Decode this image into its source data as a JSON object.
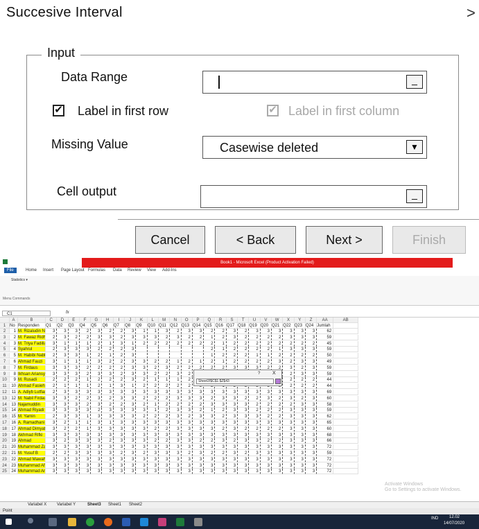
{
  "dialog": {
    "title": "Succesive Interval",
    "close": ">",
    "input_legend": "Input",
    "data_range_label": "Data Range",
    "data_range_value": "",
    "label_first_row": "Label in first row",
    "label_first_row_checked": true,
    "label_first_column": "Label in first column",
    "label_first_column_checked": true,
    "missing_value_label": "Missing Value",
    "missing_value_selected": "Casewise deleted",
    "cell_output_label": "Cell output",
    "cell_output_value": "",
    "buttons": {
      "cancel": "Cancel",
      "back": "< Back",
      "next": "Next >",
      "finish": "Finish"
    },
    "button_glyph": "_",
    "dropdown_glyph": "▼",
    "check_glyph": "✔"
  },
  "excel": {
    "title": "Book1 - Microsoft Excel (Product Activation Failed)",
    "tabs": [
      "File",
      "Home",
      "Insert",
      "Page Layout",
      "Formulas",
      "Data",
      "Review",
      "View",
      "Add-Ins"
    ],
    "statistics_menu": "Statistics ▾",
    "menu_commands": "Menu Commands",
    "name_box": "C1",
    "fx": "fx",
    "columns": [
      "A",
      "B",
      "C",
      "D",
      "E",
      "F",
      "G",
      "H",
      "I",
      "J",
      "K",
      "L",
      "M",
      "N",
      "O",
      "P",
      "Q",
      "R",
      "S",
      "T",
      "U",
      "V",
      "W",
      "X",
      "Y",
      "Z",
      "AA",
      "AB"
    ],
    "header_row": [
      "No",
      "Responden",
      "Q1",
      "Q2",
      "Q3",
      "Q4",
      "Q5",
      "Q6",
      "Q7",
      "Q8",
      "Q9",
      "Q10",
      "Q11",
      "Q12",
      "Q13",
      "Q14",
      "Q15",
      "Q16",
      "Q17",
      "Q18",
      "Q19",
      "Q20",
      "Q21",
      "Q22",
      "Q23",
      "Q24",
      "Jumlah"
    ],
    "rows": [
      {
        "no": "1",
        "name": "M. Rizaludin Nor Char",
        "q": [
          "3",
          "3",
          "3",
          "2",
          "3",
          "2",
          "2",
          "3",
          "1",
          "1",
          "3",
          "2",
          "3",
          "3",
          "2",
          "2",
          "3",
          "2",
          "3",
          "3",
          "3",
          "3",
          "3",
          "3"
        ],
        "total": "62"
      },
      {
        "no": "2",
        "name": "M. Fawaz Ridho Hifzh",
        "q": [
          "2",
          "3",
          "2",
          "2",
          "3",
          "3",
          "2",
          "3",
          "3",
          "3",
          "2",
          "3",
          "2",
          "2",
          "1",
          "2",
          "3",
          "2",
          "2",
          "2",
          "2",
          "3",
          "3",
          "3"
        ],
        "total": "59"
      },
      {
        "no": "3",
        "name": "M. Triya Fadillah",
        "q": [
          "3",
          "1",
          "1",
          "1",
          "2",
          "1",
          "3",
          "1",
          "2",
          "2",
          "2",
          "2",
          "2",
          "2",
          "2",
          "1",
          "2",
          "2",
          "2",
          "2",
          "2",
          "2",
          "2",
          "2"
        ],
        "total": "45"
      },
      {
        "no": "4",
        "name": "Syahrul",
        "q": [
          "2",
          "3",
          "3",
          "3",
          "2",
          "2",
          "2",
          "3",
          "",
          "",
          "",
          "",
          "",
          "",
          "2",
          "1",
          "2",
          "2",
          "2",
          "2",
          "1",
          "3",
          "3",
          "3"
        ],
        "total": "59"
      },
      {
        "no": "5",
        "name": "M. Habibi Nabhani",
        "q": [
          "2",
          "3",
          "3",
          "1",
          "2",
          "1",
          "2",
          "3",
          "",
          "",
          "",
          "",
          "",
          "",
          "1",
          "2",
          "2",
          "2",
          "1",
          "1",
          "2",
          "2",
          "2",
          "2"
        ],
        "total": "50"
      },
      {
        "no": "6",
        "name": "Ahmad Fauzi",
        "q": [
          "3",
          "1",
          "1",
          "1",
          "3",
          "2",
          "2",
          "3",
          "3",
          "2",
          "2",
          "1",
          "2",
          "1",
          "2",
          "1",
          "2",
          "2",
          "2",
          "2",
          "3",
          "2",
          "3",
          "3"
        ],
        "total": "49"
      },
      {
        "no": "7",
        "name": "M. Firdaus",
        "q": [
          "3",
          "3",
          "3",
          "2",
          "2",
          "2",
          "2",
          "3",
          "3",
          "2",
          "3",
          "2",
          "2",
          "2",
          "2",
          "2",
          "3",
          "3",
          "3",
          "2",
          "2",
          "3",
          "2",
          "3"
        ],
        "total": "59"
      },
      {
        "no": "8",
        "name": "Ikhsan Ariansyah",
        "q": [
          "3",
          "3",
          "3",
          "2",
          "3",
          "3",
          "2",
          "3",
          "3",
          "2",
          "2",
          "3",
          "2",
          "2",
          "3",
          "2",
          "3",
          "3",
          "3",
          "2",
          "2",
          "2",
          "3",
          "3"
        ],
        "total": "59"
      },
      {
        "no": "9",
        "name": "M. Rusadi",
        "q": [
          "2",
          "2",
          "2",
          "1",
          "2",
          "2",
          "2",
          "3",
          "2",
          "1",
          "1",
          "1",
          "2",
          "2",
          "2",
          "1",
          "2",
          "2",
          "1",
          "2",
          "1",
          "2",
          "2",
          "2"
        ],
        "total": "44"
      },
      {
        "no": "10",
        "name": "Ahmad Fasieh",
        "q": [
          "2",
          "1",
          "1",
          "1",
          "2",
          "1",
          "3",
          "1",
          "2",
          "2",
          "2",
          "2",
          "2",
          "2",
          "2",
          "1",
          "2",
          "2",
          "2",
          "2",
          "2",
          "2",
          "2",
          "2"
        ],
        "total": "44"
      },
      {
        "no": "11",
        "name": "A. Adiyb Lutfian Noor",
        "q": [
          "2",
          "3",
          "3",
          "3",
          "3",
          "3",
          "3",
          "3",
          "3",
          "3",
          "3",
          "3",
          "3",
          "3",
          "3",
          "3",
          "3",
          "3",
          "3",
          "3",
          "3",
          "3",
          "3",
          "3"
        ],
        "total": "69"
      },
      {
        "no": "12",
        "name": "M. Nabil Firdaus",
        "q": [
          "3",
          "3",
          "2",
          "2",
          "3",
          "2",
          "3",
          "3",
          "2",
          "2",
          "2",
          "3",
          "3",
          "3",
          "2",
          "3",
          "3",
          "2",
          "2",
          "3",
          "2",
          "3",
          "2",
          "3"
        ],
        "total": "60"
      },
      {
        "no": "13",
        "name": "Najamuddin",
        "q": [
          "3",
          "3",
          "3",
          "2",
          "3",
          "2",
          "2",
          "3",
          "2",
          "1",
          "2",
          "2",
          "2",
          "2",
          "3",
          "3",
          "3",
          "3",
          "2",
          "2",
          "2",
          "2",
          "3",
          "3"
        ],
        "total": "58"
      },
      {
        "no": "14",
        "name": "Ahmad Riyadi",
        "q": [
          "3",
          "3",
          "3",
          "3",
          "2",
          "3",
          "3",
          "3",
          "3",
          "1",
          "2",
          "3",
          "3",
          "2",
          "1",
          "2",
          "3",
          "3",
          "2",
          "2",
          "2",
          "3",
          "3",
          "3"
        ],
        "total": "59"
      },
      {
        "no": "15",
        "name": "M. Yamin",
        "q": [
          "2",
          "3",
          "3",
          "1",
          "3",
          "3",
          "3",
          "3",
          "2",
          "2",
          "2",
          "3",
          "2",
          "3",
          "3",
          "2",
          "3",
          "3",
          "3",
          "2",
          "2",
          "3",
          "3",
          "3"
        ],
        "total": "62"
      },
      {
        "no": "16",
        "name": "A. Ramadhani",
        "q": [
          "3",
          "2",
          "1",
          "1",
          "3",
          "1",
          "3",
          "3",
          "3",
          "3",
          "3",
          "3",
          "3",
          "3",
          "3",
          "3",
          "3",
          "3",
          "3",
          "3",
          "3",
          "3",
          "3",
          "3"
        ],
        "total": "65"
      },
      {
        "no": "17",
        "name": "Ahmad Dimyati",
        "q": [
          "3",
          "2",
          "2",
          "1",
          "3",
          "3",
          "3",
          "3",
          "3",
          "2",
          "2",
          "3",
          "3",
          "3",
          "3",
          "2",
          "3",
          "2",
          "2",
          "2",
          "2",
          "3",
          "3",
          "3"
        ],
        "total": "60"
      },
      {
        "no": "18",
        "name": "Akhmad Rifki",
        "q": [
          "3",
          "3",
          "3",
          "3",
          "3",
          "3",
          "3",
          "3",
          "3",
          "3",
          "3",
          "3",
          "3",
          "3",
          "3",
          "3",
          "3",
          "3",
          "3",
          "3",
          "3",
          "3",
          "3",
          "3"
        ],
        "total": "68"
      },
      {
        "no": "19",
        "name": "Ahmad",
        "q": [
          "3",
          "2",
          "3",
          "3",
          "3",
          "2",
          "3",
          "3",
          "3",
          "2",
          "2",
          "3",
          "3",
          "2",
          "2",
          "3",
          "2",
          "3",
          "3",
          "2",
          "2",
          "3",
          "3",
          "3"
        ],
        "total": "66"
      },
      {
        "no": "20",
        "name": "Muhammad Zaini",
        "q": [
          "3",
          "3",
          "3",
          "3",
          "3",
          "3",
          "3",
          "3",
          "3",
          "3",
          "3",
          "3",
          "3",
          "3",
          "3",
          "3",
          "3",
          "3",
          "3",
          "3",
          "3",
          "3",
          "3",
          "3"
        ],
        "total": "72"
      },
      {
        "no": "21",
        "name": "M. Yusuf B",
        "q": [
          "2",
          "2",
          "3",
          "3",
          "3",
          "3",
          "2",
          "3",
          "2",
          "3",
          "3",
          "3",
          "2",
          "3",
          "2",
          "2",
          "3",
          "2",
          "3",
          "3",
          "3",
          "3",
          "3",
          "3"
        ],
        "total": "59"
      },
      {
        "no": "22",
        "name": "Ahmad Mawahib",
        "q": [
          "3",
          "3",
          "3",
          "3",
          "3",
          "3",
          "3",
          "3",
          "3",
          "3",
          "3",
          "3",
          "3",
          "3",
          "3",
          "3",
          "3",
          "3",
          "3",
          "3",
          "3",
          "3",
          "3",
          "3"
        ],
        "total": "72"
      },
      {
        "no": "23",
        "name": "Muhammad Afif",
        "q": [
          "3",
          "3",
          "3",
          "3",
          "3",
          "3",
          "3",
          "3",
          "3",
          "3",
          "3",
          "3",
          "3",
          "3",
          "3",
          "3",
          "3",
          "3",
          "3",
          "3",
          "3",
          "3",
          "3",
          "3"
        ],
        "total": "72"
      },
      {
        "no": "24",
        "name": "Muhammad Ansyari",
        "q": [
          "3",
          "3",
          "3",
          "3",
          "3",
          "3",
          "3",
          "3",
          "3",
          "3",
          "3",
          "3",
          "3",
          "3",
          "3",
          "3",
          "3",
          "3",
          "3",
          "3",
          "3",
          "3",
          "3",
          "3"
        ],
        "total": "72"
      }
    ],
    "popup": {
      "question": "?",
      "close": "X",
      "ref": "Sheet3!$C$1:$Z$43"
    },
    "sheet_tabs": [
      "Variabel X",
      "Variabel Y",
      "Sheet3",
      "Sheet1",
      "Sheet2"
    ],
    "status": "Point",
    "watermark": "Activate Windows\nGo to Settings to activate Windows.",
    "tray": {
      "lang": "IND",
      "time": "12.02",
      "date": "14/07/2020"
    }
  }
}
